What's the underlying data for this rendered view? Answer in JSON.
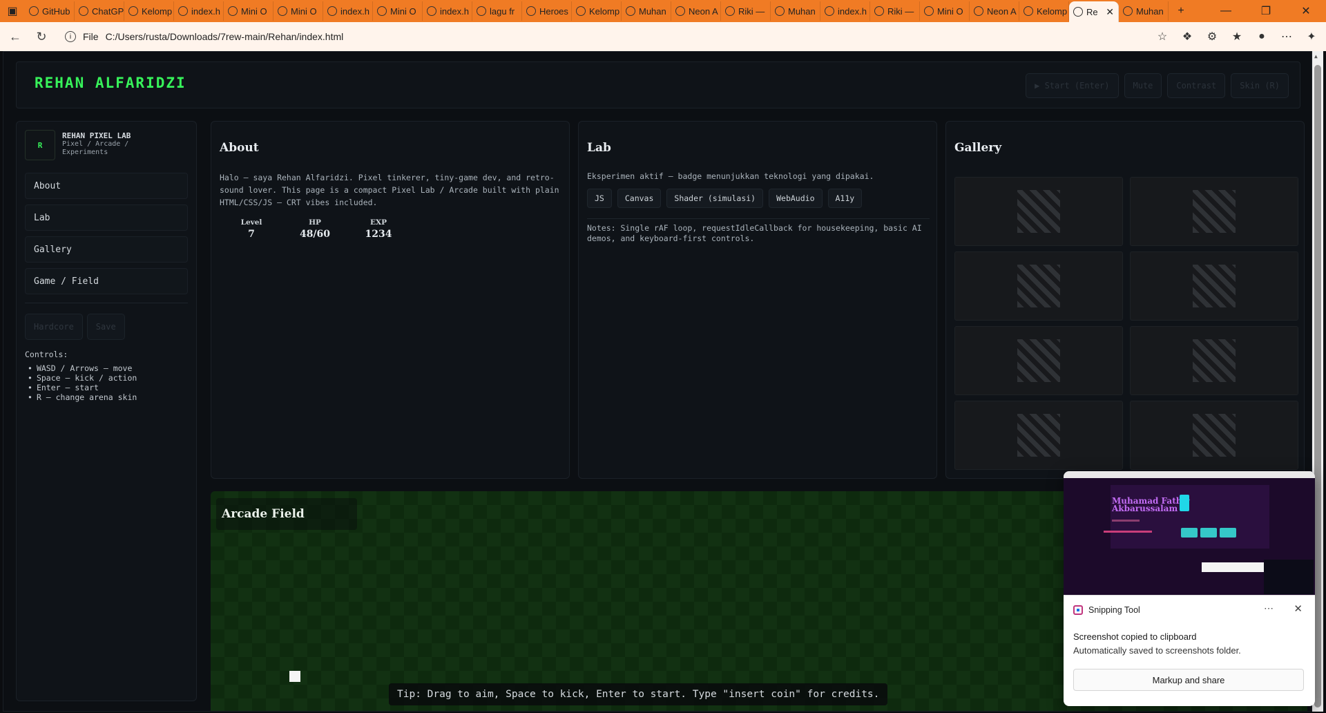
{
  "browser": {
    "tabs": [
      {
        "label": "",
        "icon": "window-menu-icon"
      },
      {
        "label": "GitHub",
        "icon": "github-icon"
      },
      {
        "label": "ChatGPT",
        "icon": "chatgpt-icon"
      },
      {
        "label": "Kelomp",
        "icon": "globe-icon"
      },
      {
        "label": "index.h",
        "icon": "globe-icon"
      },
      {
        "label": "Mini O",
        "icon": "globe-icon"
      },
      {
        "label": "Mini O",
        "icon": "globe-icon"
      },
      {
        "label": "index.h",
        "icon": "globe-icon"
      },
      {
        "label": "Mini O",
        "icon": "globe-icon"
      },
      {
        "label": "index.h",
        "icon": "globe-icon"
      },
      {
        "label": "lagu fr",
        "icon": "search-icon"
      },
      {
        "label": "Heroes",
        "icon": "globe-icon"
      },
      {
        "label": "Kelomp",
        "icon": "globe-icon"
      },
      {
        "label": "Muhan",
        "icon": "globe-icon"
      },
      {
        "label": "Neon A",
        "icon": "globe-icon"
      },
      {
        "label": "Riki —",
        "icon": "globe-icon"
      },
      {
        "label": "Muhan",
        "icon": "globe-icon"
      },
      {
        "label": "index.h",
        "icon": "globe-icon"
      },
      {
        "label": "Riki —",
        "icon": "globe-icon"
      },
      {
        "label": "Mini O",
        "icon": "globe-icon"
      },
      {
        "label": "Neon A",
        "icon": "globe-icon"
      },
      {
        "label": "Kelomp",
        "icon": "globe-icon"
      },
      {
        "label": "Re",
        "icon": "globe-icon",
        "active": true
      },
      {
        "label": "Muhan",
        "icon": "globe-icon"
      }
    ],
    "new_tab": "+",
    "address_prefix": "File",
    "url": "C:/Users/rusta/Downloads/7rew-main/Rehan/index.html",
    "accent_color": "#f07b24"
  },
  "page": {
    "site_title": "REHAN ALFARIDZI",
    "header_buttons": [
      "▶ Start (Enter)",
      "Mute",
      "Contrast",
      "Skin (R)"
    ],
    "sidebar": {
      "avatar": "R",
      "brand_title": "REHAN PIXEL LAB",
      "brand_subtitle": "Pixel / Arcade / Experiments",
      "nav": [
        "About",
        "Lab",
        "Gallery",
        "Game / Field"
      ],
      "buttons": [
        "Hardcore",
        "Save"
      ],
      "controls_heading": "Controls:",
      "controls": [
        "WASD / Arrows — move",
        "Space — kick / action",
        "Enter — start",
        "R — change arena skin"
      ]
    },
    "about": {
      "title": "About",
      "body": "Halo — saya Rehan Alfaridzi. Pixel tinkerer, tiny-game dev, and retro-sound lover. This page is a compact Pixel Lab / Arcade built with plain HTML/CSS/JS — CRT vibes included.",
      "stats": [
        {
          "label": "Level",
          "value": "7"
        },
        {
          "label": "HP",
          "value": "48/60"
        },
        {
          "label": "EXP",
          "value": "1234"
        }
      ]
    },
    "lab": {
      "title": "Lab",
      "description": "Eksperimen aktif — badge menunjukkan teknologi yang dipakai.",
      "badges": [
        "JS",
        "Canvas",
        "Shader (simulasi)",
        "WebAudio",
        "A11y"
      ],
      "notes": "Notes: Single rAF loop, requestIdleCallback for housekeeping, basic AI demos, and keyboard-first controls."
    },
    "gallery": {
      "title": "Gallery",
      "items": 8
    },
    "arcade": {
      "title": "Arcade Field",
      "tip": "Tip: Drag to aim, Space to kick, Enter to start. Type \"insert coin\" for credits."
    }
  },
  "toast": {
    "app": "Snipping Tool",
    "title": "Screenshot copied to clipboard",
    "subtitle": "Automatically saved to screenshots folder.",
    "button": "Markup and share",
    "preview_name": "Muhamad Fathir Akbarussalam"
  }
}
